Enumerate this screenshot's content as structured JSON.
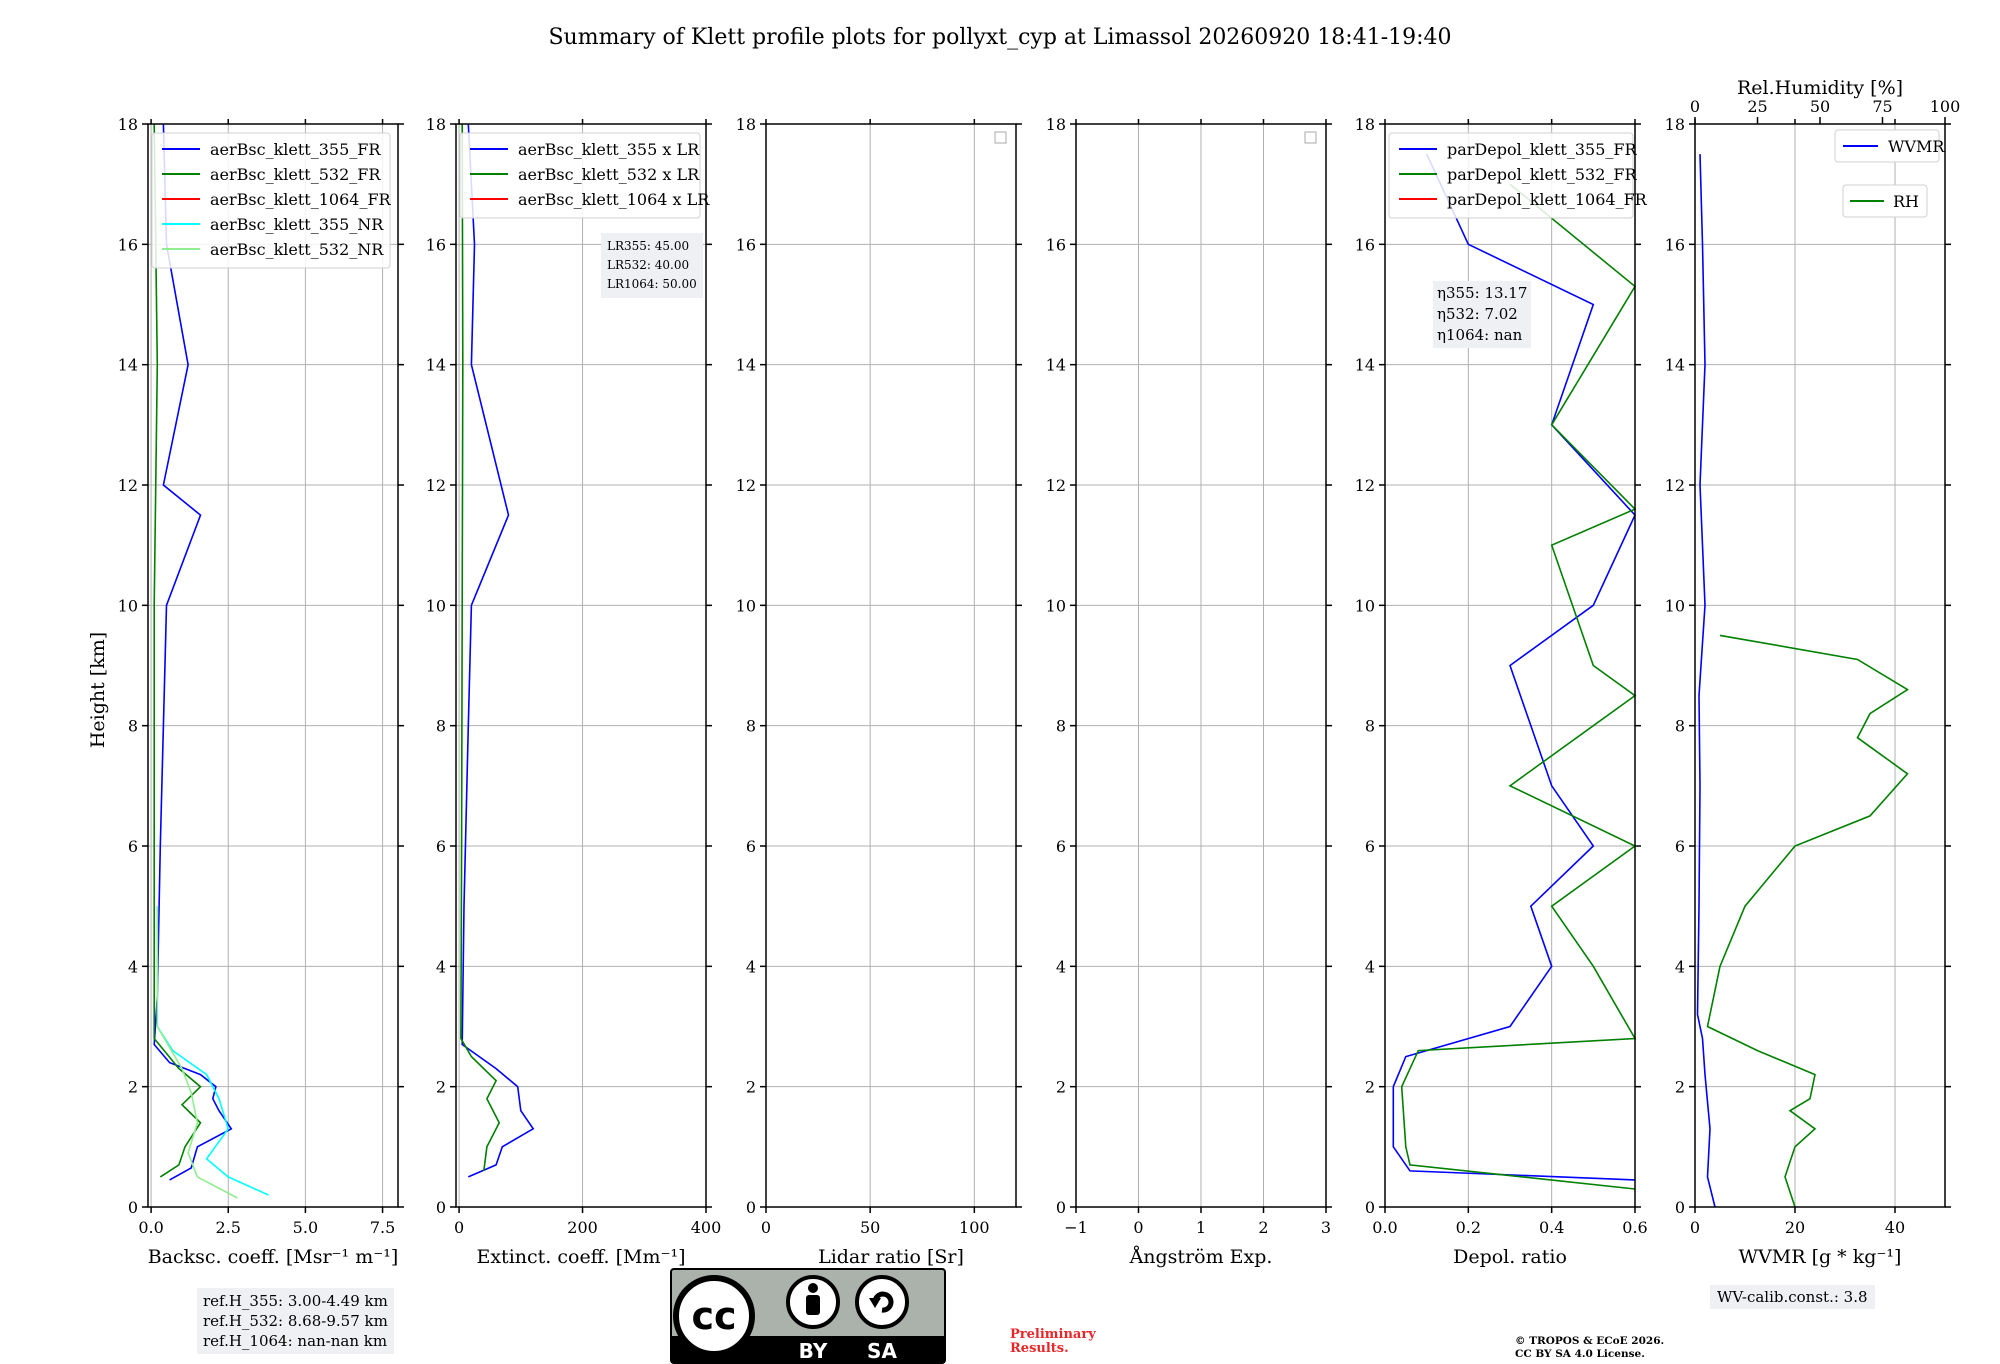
{
  "title": "Summary of Klett profile plots for pollyxt_cyp at Limassol 20260920 18:41-19:40",
  "ylabel": "Height [km]",
  "y_ticks": [
    "0",
    "2",
    "4",
    "6",
    "8",
    "10",
    "12",
    "14",
    "16",
    "18"
  ],
  "panels": [
    {
      "xlabel": "Backsc. coeff. [Msr⁻¹ m⁻¹]",
      "xticks": [
        "0.0",
        "2.5",
        "5.0",
        "7.5"
      ]
    },
    {
      "xlabel": "Extinct. coeff. [Mm⁻¹]",
      "xticks": [
        "0",
        "200",
        "400"
      ]
    },
    {
      "xlabel": "Lidar ratio [Sr]",
      "xticks": [
        "0",
        "50",
        "100"
      ]
    },
    {
      "xlabel": "Ångström Exp.",
      "xticks": [
        "−1",
        "0",
        "1",
        "2",
        "3"
      ]
    },
    {
      "xlabel": "Depol. ratio",
      "xticks": [
        "0.0",
        "0.2",
        "0.4",
        "0.6"
      ]
    },
    {
      "xlabel": "WVMR [g * kg⁻¹]",
      "xticks": [
        "0",
        "20",
        "40"
      ],
      "top_xlabel": "Rel.Humidity [%]",
      "top_xticks": [
        "0",
        "25",
        "50",
        "75",
        "100"
      ]
    }
  ],
  "legends": {
    "bsc": [
      "aerBsc_klett_355_FR",
      "aerBsc_klett_532_FR",
      "aerBsc_klett_1064_FR",
      "aerBsc_klett_355_NR",
      "aerBsc_klett_532_NR"
    ],
    "ext": [
      "aerBsc_klett_355 x LR",
      "aerBsc_klett_532 x LR",
      "aerBsc_klett_1064 x LR"
    ],
    "depol": [
      "parDepol_klett_355_FR",
      "parDepol_klett_532_FR",
      "parDepol_klett_1064_FR"
    ],
    "wvmr": "WVMR",
    "rh": "RH"
  },
  "lr_box": [
    "LR355: 45.00",
    "LR532: 40.00",
    "LR1064: 50.00"
  ],
  "eta_box": [
    "η355: 13.17",
    "η532: 7.02",
    "η1064: nan"
  ],
  "ref_box": [
    "ref.H_355: 3.00-4.49 km",
    "ref.H_532: 8.68-9.57 km",
    "ref.H_1064: nan-nan km"
  ],
  "wv_calib": "WV-calib.const.: 3.8",
  "preliminary": [
    "Preliminary",
    "Results."
  ],
  "copyright": [
    "© TROPOS & ECoE 2026.",
    "CC BY SA 4.0 License."
  ],
  "cc_badge": {
    "letters": "cc",
    "by": "BY",
    "sa": "SA"
  },
  "colors": {
    "c355": "#0000ff",
    "c532": "#008000",
    "c1064": "#ff0000",
    "c355nr": "#00ffff",
    "c532nr": "#90ee90",
    "grid": "#b0b0b0"
  },
  "chart_data": {
    "type": "line",
    "ylim": [
      0,
      18
    ],
    "panels": [
      {
        "name": "backscatter",
        "xlim": [
          -0.1,
          8.0
        ],
        "series": [
          {
            "name": "aerBsc_klett_355_FR",
            "points": [
              [
                0.6,
                0.45
              ],
              [
                1.3,
                0.65
              ],
              [
                1.5,
                1.0
              ],
              [
                2.6,
                1.3
              ],
              [
                2.2,
                1.6
              ],
              [
                2.0,
                1.8
              ],
              [
                2.1,
                2.0
              ],
              [
                1.6,
                2.2
              ],
              [
                0.6,
                2.4
              ],
              [
                0.1,
                2.7
              ],
              [
                0.2,
                3.5
              ],
              [
                0.3,
                6.0
              ],
              [
                0.4,
                8.0
              ],
              [
                0.5,
                10.0
              ],
              [
                1.6,
                11.5
              ],
              [
                0.4,
                12.0
              ],
              [
                1.2,
                14.0
              ],
              [
                0.5,
                16.0
              ],
              [
                0.4,
                18.0
              ]
            ]
          },
          {
            "name": "aerBsc_klett_532_FR",
            "points": [
              [
                0.3,
                0.5
              ],
              [
                0.9,
                0.7
              ],
              [
                1.1,
                1.0
              ],
              [
                1.6,
                1.4
              ],
              [
                1.0,
                1.7
              ],
              [
                1.6,
                2.0
              ],
              [
                0.9,
                2.3
              ],
              [
                0.1,
                2.8
              ],
              [
                0.1,
                6.0
              ],
              [
                0.1,
                10.0
              ],
              [
                0.2,
                14.0
              ],
              [
                0.1,
                18.0
              ]
            ]
          },
          {
            "name": "aerBsc_klett_355_NR",
            "points": [
              [
                3.8,
                0.2
              ],
              [
                2.5,
                0.5
              ],
              [
                1.8,
                0.8
              ],
              [
                2.5,
                1.3
              ],
              [
                2.2,
                1.8
              ],
              [
                1.8,
                2.2
              ],
              [
                0.7,
                2.6
              ],
              [
                0.2,
                3.0
              ],
              [
                0.2,
                5.0
              ]
            ]
          },
          {
            "name": "aerBsc_klett_532_NR",
            "points": [
              [
                2.8,
                0.15
              ],
              [
                1.5,
                0.5
              ],
              [
                1.2,
                0.9
              ],
              [
                1.5,
                1.4
              ],
              [
                1.3,
                1.9
              ],
              [
                1.0,
                2.3
              ],
              [
                0.2,
                3.0
              ],
              [
                0.2,
                5.0
              ]
            ]
          }
        ]
      },
      {
        "name": "extinction",
        "xlim": [
          -5,
          400
        ],
        "series": [
          {
            "name": "aerBsc_klett_355 x LR",
            "points": [
              [
                15,
                0.5
              ],
              [
                60,
                0.7
              ],
              [
                70,
                1.0
              ],
              [
                120,
                1.3
              ],
              [
                100,
                1.6
              ],
              [
                95,
                2.0
              ],
              [
                60,
                2.3
              ],
              [
                5,
                2.7
              ],
              [
                8,
                5.0
              ],
              [
                15,
                8.0
              ],
              [
                20,
                10.0
              ],
              [
                80,
                11.5
              ],
              [
                20,
                14.0
              ],
              [
                25,
                16.0
              ],
              [
                15,
                18.0
              ]
            ]
          },
          {
            "name": "aerBsc_klett_532 x LR",
            "points": [
              [
                40,
                0.6
              ],
              [
                45,
                1.0
              ],
              [
                65,
                1.4
              ],
              [
                45,
                1.8
              ],
              [
                60,
                2.1
              ],
              [
                20,
                2.5
              ],
              [
                3,
                2.8
              ],
              [
                4,
                6.0
              ],
              [
                5,
                10.0
              ],
              [
                6,
                14.0
              ],
              [
                5,
                18.0
              ]
            ]
          }
        ]
      },
      {
        "name": "lidar_ratio",
        "xlim": [
          0,
          120
        ],
        "series": []
      },
      {
        "name": "angstrom",
        "xlim": [
          -1,
          3
        ],
        "series": []
      },
      {
        "name": "depol",
        "xlim": [
          0,
          0.6
        ],
        "series": [
          {
            "name": "parDepol_klett_355_FR",
            "points": [
              [
                0.6,
                0.45
              ],
              [
                0.06,
                0.6
              ],
              [
                0.02,
                1.0
              ],
              [
                0.02,
                2.0
              ],
              [
                0.05,
                2.5
              ],
              [
                0.3,
                3.0
              ],
              [
                0.4,
                4.0
              ],
              [
                0.35,
                5.0
              ],
              [
                0.5,
                6.0
              ],
              [
                0.4,
                7.0
              ],
              [
                0.3,
                9.0
              ],
              [
                0.5,
                10.0
              ],
              [
                0.6,
                11.5
              ],
              [
                0.4,
                13.0
              ],
              [
                0.5,
                15.0
              ],
              [
                0.2,
                16.0
              ],
              [
                0.1,
                17.5
              ]
            ]
          },
          {
            "name": "parDepol_klett_532_FR",
            "points": [
              [
                0.6,
                0.3
              ],
              [
                0.06,
                0.7
              ],
              [
                0.05,
                1.0
              ],
              [
                0.04,
                2.0
              ],
              [
                0.08,
                2.6
              ],
              [
                0.6,
                2.8
              ],
              [
                0.5,
                4.0
              ],
              [
                0.4,
                5.0
              ],
              [
                0.6,
                6.0
              ],
              [
                0.3,
                7.0
              ],
              [
                0.6,
                8.5
              ],
              [
                0.5,
                9.0
              ],
              [
                0.4,
                11.0
              ],
              [
                0.6,
                11.6
              ],
              [
                0.4,
                13.0
              ],
              [
                0.6,
                15.3
              ],
              [
                0.3,
                17.0
              ]
            ]
          }
        ]
      },
      {
        "name": "wvmr_rh",
        "xlim": [
          0,
          50
        ],
        "top_xlim": [
          0,
          100
        ],
        "series": [
          {
            "name": "WVMR",
            "points": [
              [
                4,
                0.0
              ],
              [
                2.5,
                0.5
              ],
              [
                3,
                1.3
              ],
              [
                2,
                2.2
              ],
              [
                1.5,
                2.8
              ],
              [
                0.5,
                3.2
              ],
              [
                0.8,
                5.0
              ],
              [
                1,
                7.0
              ],
              [
                0.8,
                8.5
              ],
              [
                2,
                10.0
              ],
              [
                1,
                12.0
              ],
              [
                2,
                14.0
              ],
              [
                1.5,
                16.0
              ],
              [
                1,
                17.5
              ]
            ]
          },
          {
            "name": "RH",
            "points": [
              [
                40,
                0.0
              ],
              [
                36,
                0.5
              ],
              [
                40,
                1.0
              ],
              [
                48,
                1.3
              ],
              [
                38,
                1.6
              ],
              [
                46,
                1.8
              ],
              [
                48,
                2.2
              ],
              [
                25,
                2.6
              ],
              [
                5,
                3.0
              ],
              [
                10,
                4.0
              ],
              [
                20,
                5.0
              ],
              [
                40,
                6.0
              ],
              [
                70,
                6.5
              ],
              [
                85,
                7.2
              ],
              [
                65,
                7.8
              ],
              [
                70,
                8.2
              ],
              [
                85,
                8.6
              ],
              [
                65,
                9.1
              ],
              [
                10,
                9.5
              ]
            ]
          }
        ]
      }
    ]
  }
}
